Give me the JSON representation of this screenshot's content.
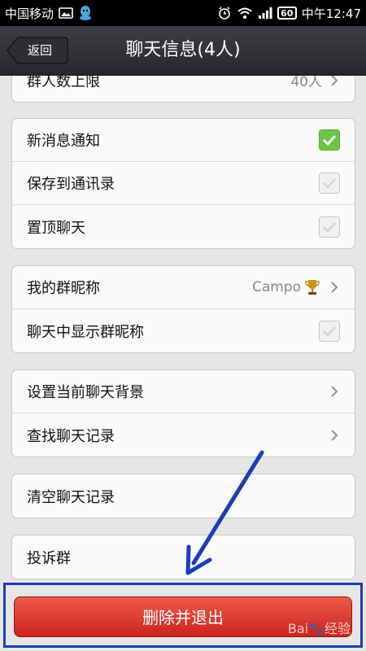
{
  "status_bar": {
    "carrier": "中国移动",
    "battery": "60",
    "time": "中午12:47",
    "icons": [
      "image-icon",
      "qq-icon",
      "alarm-icon",
      "wifi-icon",
      "signal-icon",
      "battery-icon"
    ]
  },
  "header": {
    "back_label": "返回",
    "title": "聊天信息(4人)"
  },
  "sections": {
    "top": {
      "label": "群人数上限",
      "value": "40人"
    },
    "notifications": [
      {
        "label": "新消息通知",
        "checked": true
      },
      {
        "label": "保存到通讯录",
        "checked": false
      },
      {
        "label": "置顶聊天",
        "checked": false
      }
    ],
    "nickname": {
      "label": "我的群昵称",
      "value": "Campo",
      "trophy_icon": "trophy-icon"
    },
    "show_nickname": {
      "label": "聊天中显示群昵称",
      "checked": false
    },
    "chat": [
      {
        "label": "设置当前聊天背景"
      },
      {
        "label": "查找聊天记录"
      }
    ],
    "clear": {
      "label": "清空聊天记录"
    },
    "report": {
      "label": "投诉群"
    }
  },
  "footer": {
    "delete_label": "删除并退出",
    "watermark": "Bai🐾经验"
  },
  "colors": {
    "accent_red": "#d8372b",
    "check_green": "#6cc644",
    "annotation_blue": "#1c3db5"
  }
}
